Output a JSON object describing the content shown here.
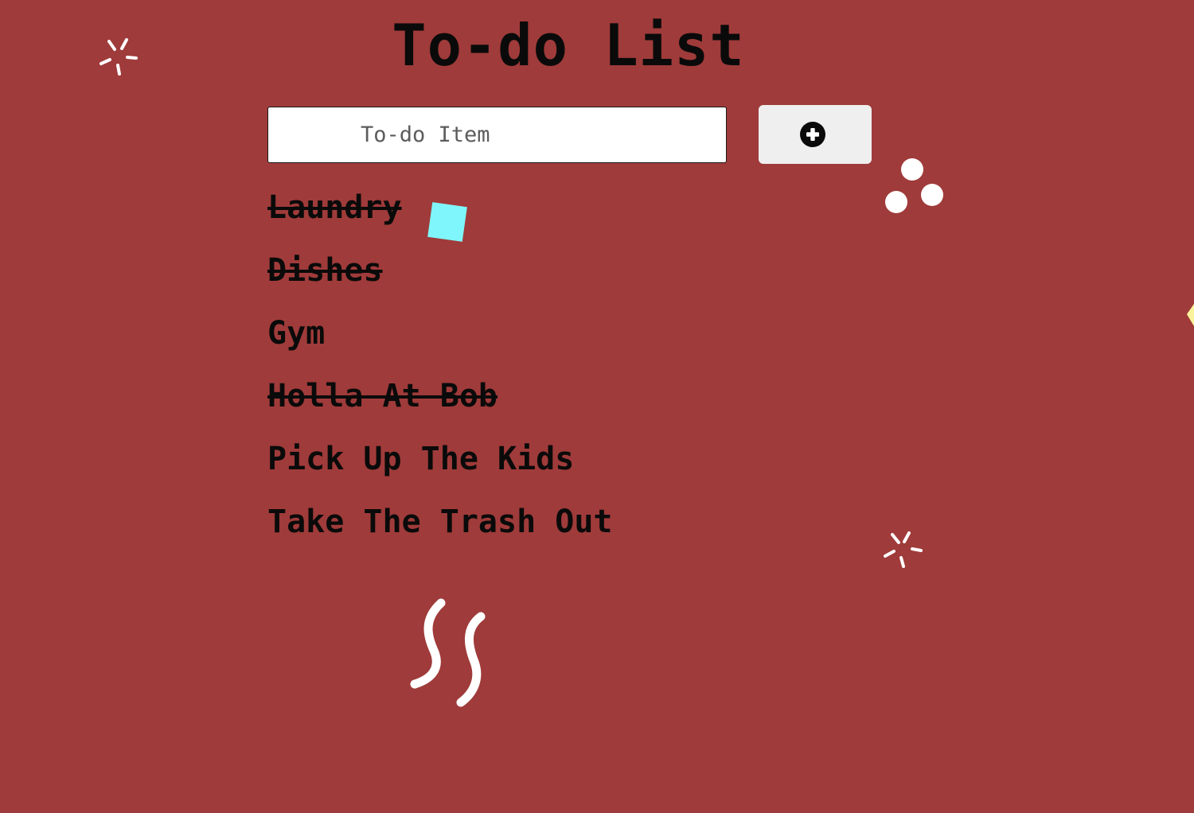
{
  "header": {
    "title": "To-do List"
  },
  "form": {
    "input_value": "",
    "input_placeholder": "To-do Item",
    "add_button_icon": "plus-circle-icon"
  },
  "todos": [
    {
      "label": "Laundry",
      "done": true
    },
    {
      "label": "Dishes",
      "done": true
    },
    {
      "label": "Gym",
      "done": false
    },
    {
      "label": "Holla At Bob",
      "done": true
    },
    {
      "label": "Pick Up The Kids",
      "done": false
    },
    {
      "label": "Take The Trash Out",
      "done": false
    }
  ],
  "colors": {
    "background": "#9f3b3a",
    "text": "#0a0a0a",
    "button_background": "#efefef",
    "confetti_white": "#ffffff",
    "confetti_cyan": "#7ff6fb",
    "confetti_yellow": "#fbf39b"
  },
  "decorations": [
    "sparkle-icon",
    "dots-cluster-icon",
    "cyan-square-shape",
    "squiggle-lines-shape",
    "sparkle-icon",
    "yellow-diamond-shape"
  ]
}
